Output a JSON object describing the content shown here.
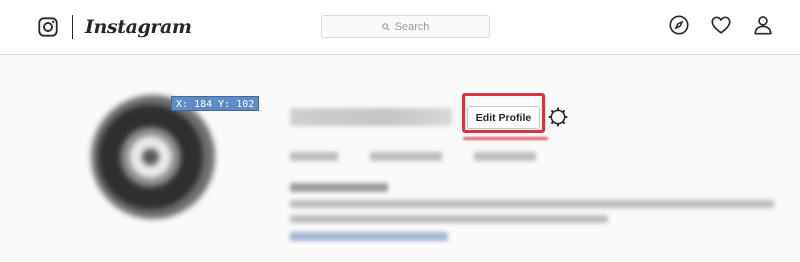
{
  "header": {
    "brand": {
      "icon": "instagram-camera-icon",
      "wordmark": "Instagram"
    },
    "search": {
      "placeholder": "Search",
      "icon": "search-icon"
    },
    "nav_icons": [
      "compass-icon",
      "heart-icon",
      "person-icon"
    ]
  },
  "overlay": {
    "coordinate_readout": "X: 184 Y: 102"
  },
  "profile": {
    "edit_button_label": "Edit Profile",
    "settings_icon": "gear-icon"
  },
  "colors": {
    "highlight": "#d9353f",
    "coordinate_badge": "#5f8cc4",
    "border": "#dbdbdb",
    "page_background": "#fafafa"
  }
}
